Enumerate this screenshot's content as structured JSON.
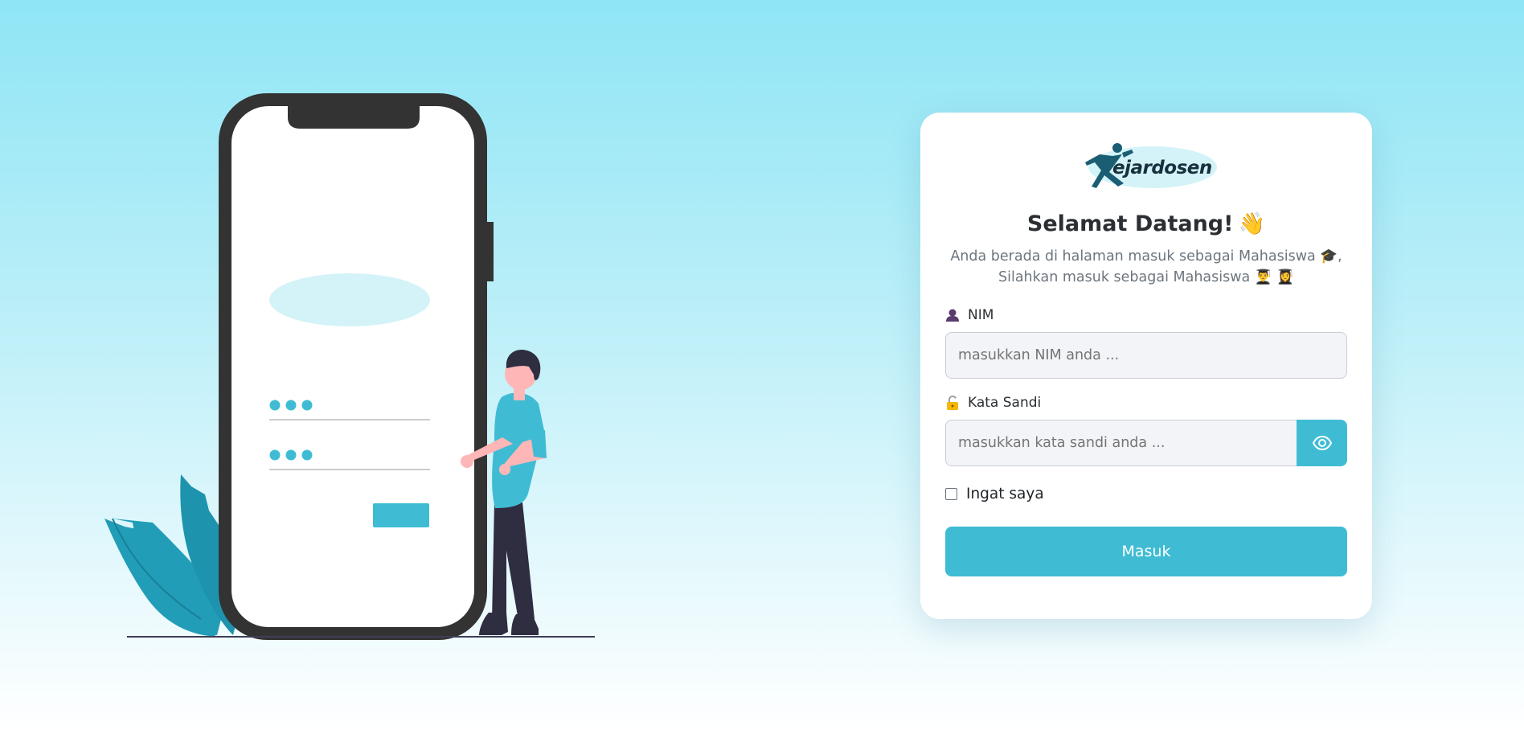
{
  "login": {
    "brand": "ejardosen",
    "title": "Selamat Datang!",
    "title_emoji": "👋",
    "subtitle_line1": "Anda berada di halaman masuk sebagai Mahasiswa 🎓,",
    "subtitle_line2": "Silahkan masuk sebagai Mahasiswa 👨‍🎓 👩‍🎓",
    "nim_label": "NIM",
    "nim_placeholder": "masukkan NIM anda ...",
    "password_label": "Kata Sandi",
    "password_placeholder": "masukkan kata sandi anda ...",
    "remember_label": "Ingat saya",
    "submit_label": "Masuk"
  },
  "icons": {
    "nim": "user-icon",
    "password": "lock-icon",
    "toggle_password": "eye-icon"
  },
  "colors": {
    "accent": "#3fbcd4",
    "leaf": "#229db7",
    "phone_frame": "#333333",
    "person_hair": "#2f2e41",
    "person_skin": "#ffb6b6",
    "background_top": "#8fe5f5"
  }
}
